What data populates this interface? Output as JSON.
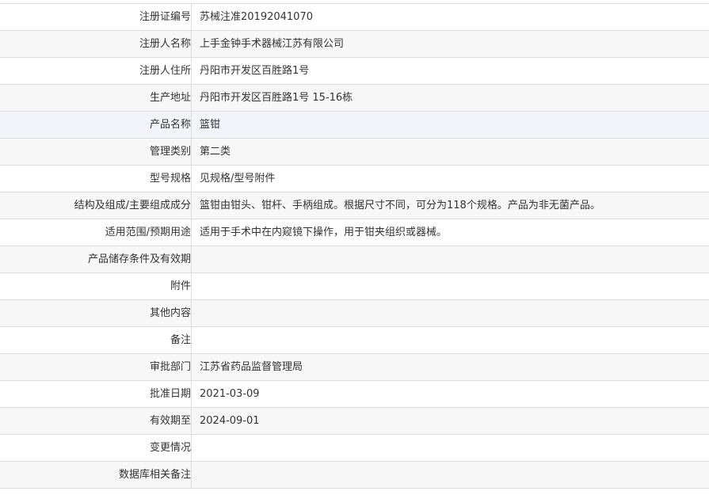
{
  "rows": [
    {
      "label": "注册证编号",
      "value": "苏械注准20192041070"
    },
    {
      "label": "注册人名称",
      "value": "上手金钟手术器械江苏有限公司"
    },
    {
      "label": "注册人住所",
      "value": "丹阳市开发区百胜路1号"
    },
    {
      "label": "生产地址",
      "value": "丹阳市开发区百胜路1号 15-16栋"
    },
    {
      "label": "产品名称",
      "value": "篮钳"
    },
    {
      "label": "管理类别",
      "value": "第二类"
    },
    {
      "label": "型号规格",
      "value": "见规格/型号附件"
    },
    {
      "label": "结构及组成/主要组成成分",
      "value": "篮钳由钳头、钳杆、手柄组成。根据尺寸不同，可分为118个规格。产品为非无菌产品。"
    },
    {
      "label": "适用范围/预期用途",
      "value": "适用于手术中在内窥镜下操作，用于钳夹组织或器械。"
    },
    {
      "label": "产品储存条件及有效期",
      "value": ""
    },
    {
      "label": "附件",
      "value": ""
    },
    {
      "label": "其他内容",
      "value": ""
    },
    {
      "label": "备注",
      "value": ""
    },
    {
      "label": "审批部门",
      "value": "江苏省药品监督管理局"
    },
    {
      "label": "批准日期",
      "value": "2021-03-09"
    },
    {
      "label": "有效期至",
      "value": "2024-09-01"
    },
    {
      "label": "变更情况",
      "value": ""
    },
    {
      "label": "数据库相关备注",
      "value": ""
    }
  ]
}
